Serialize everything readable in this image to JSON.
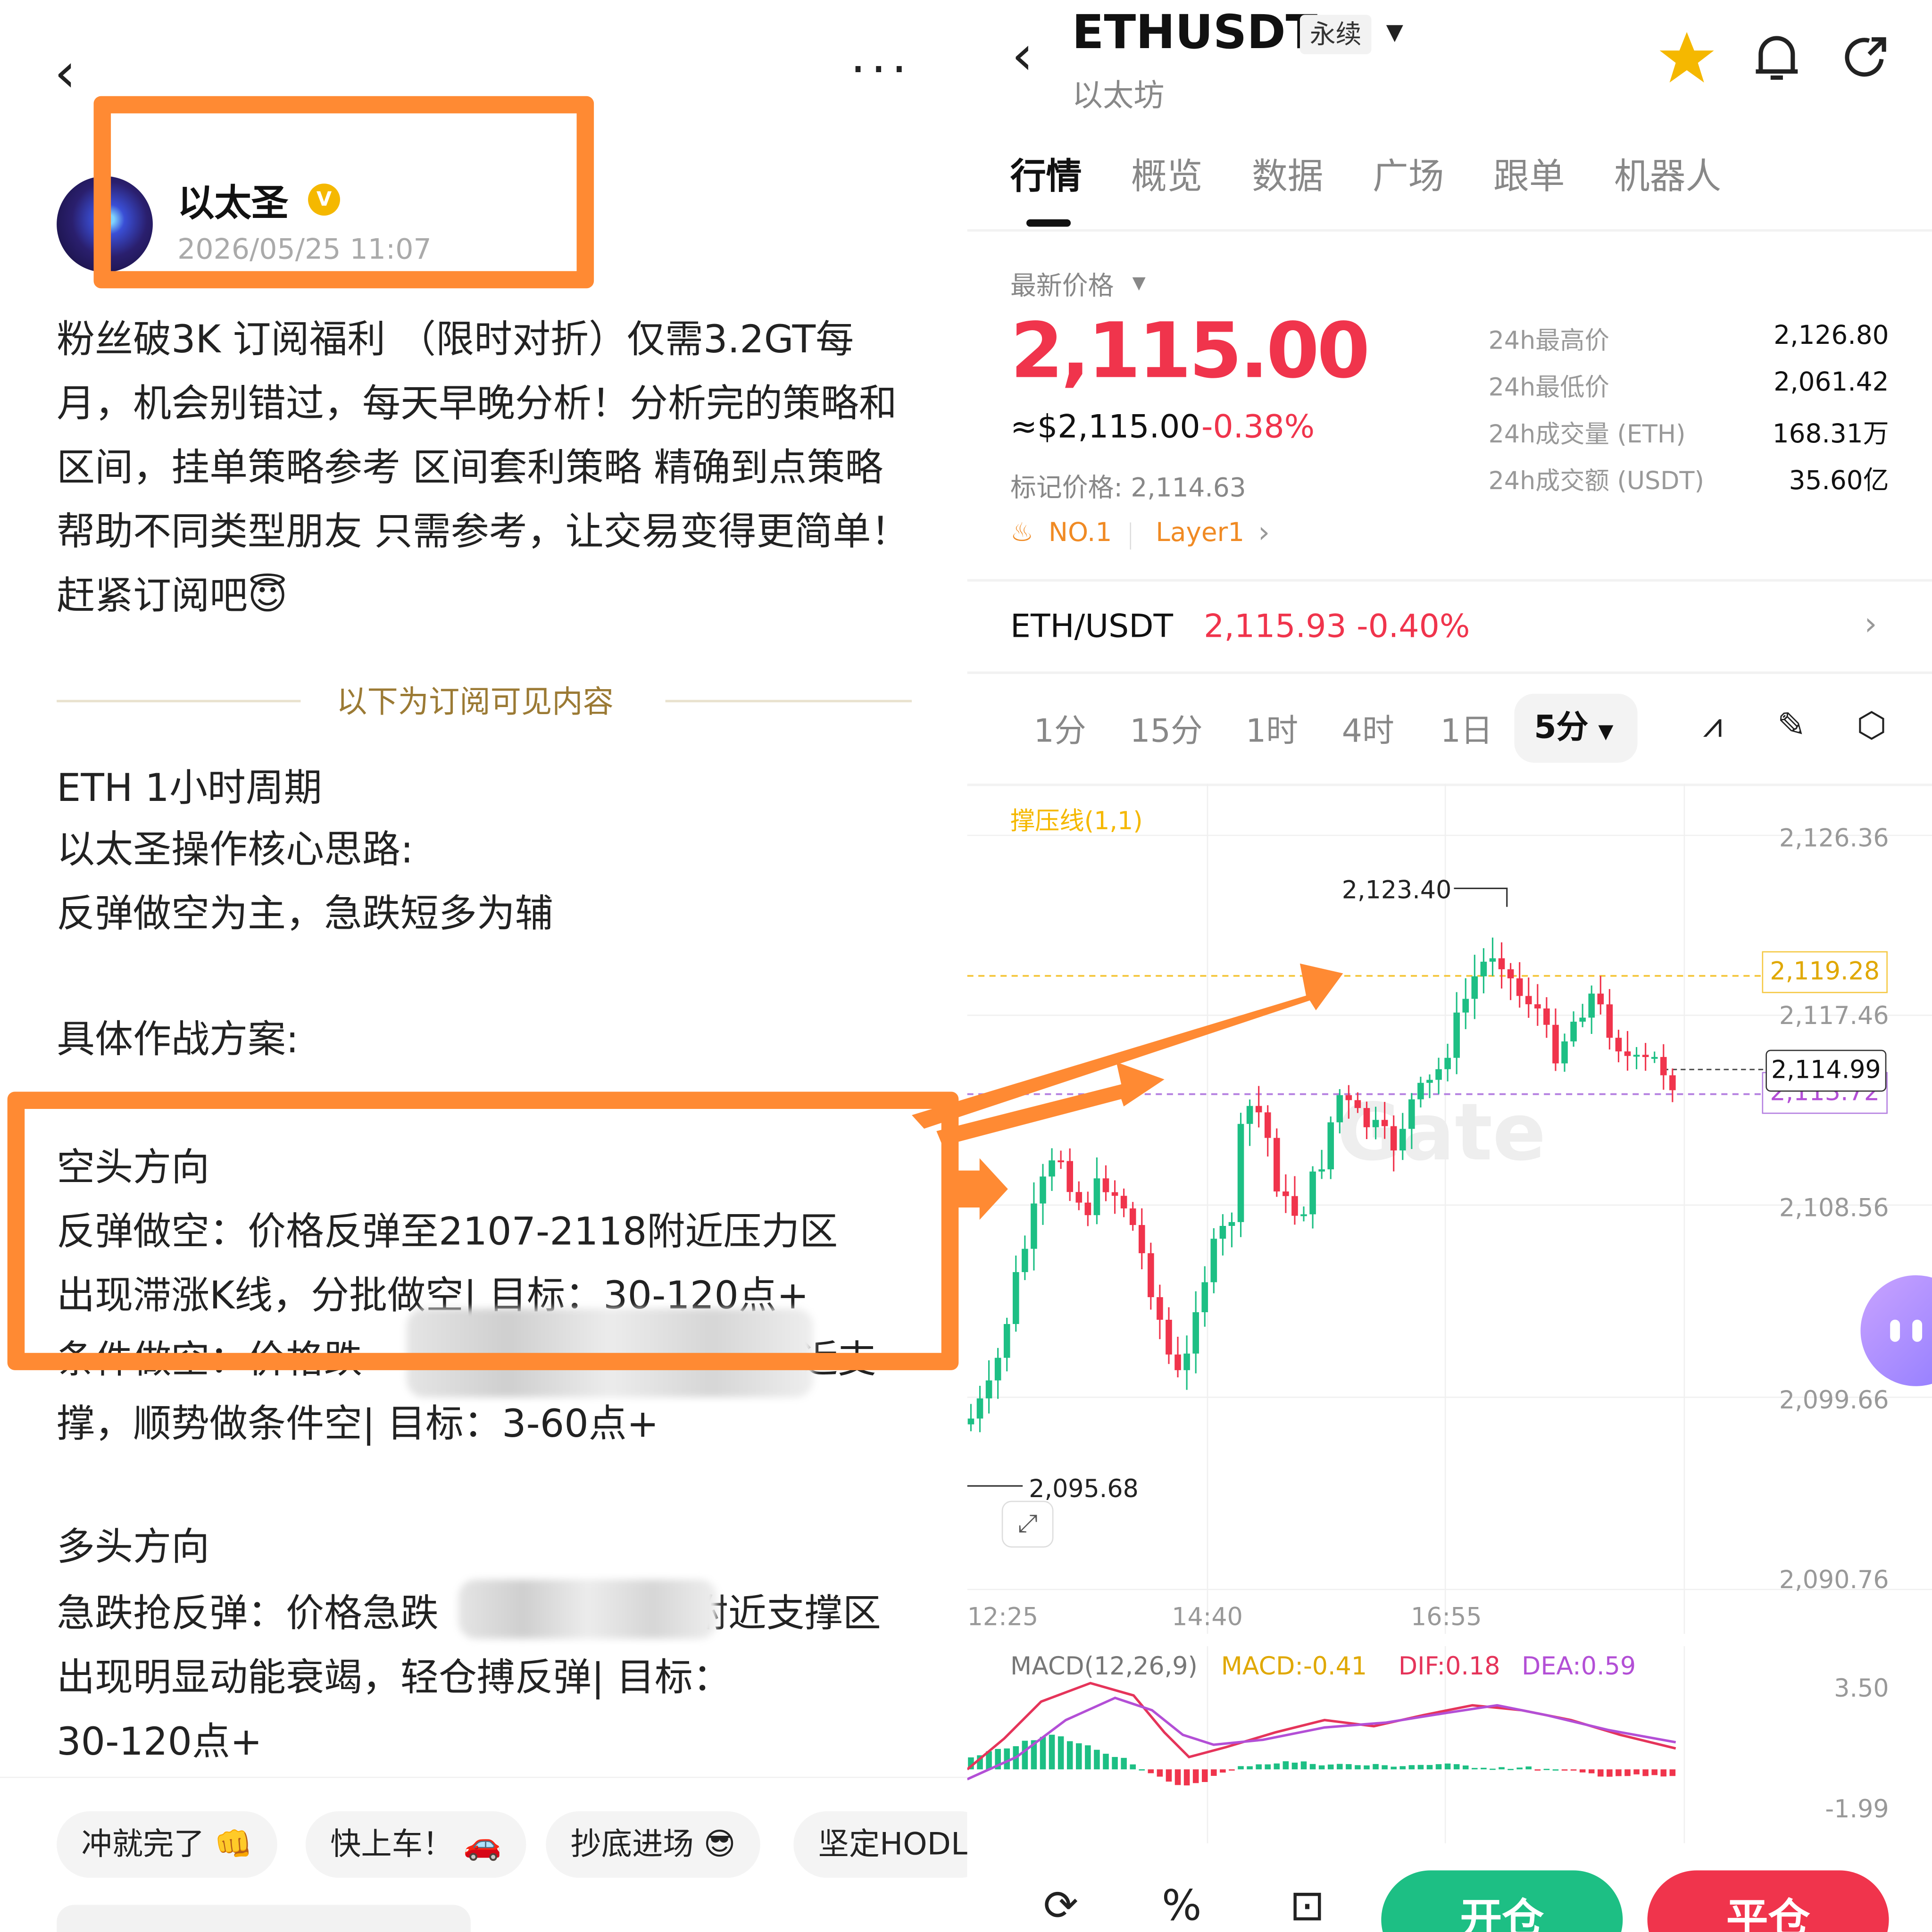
{
  "post": {
    "author": "以太圣",
    "verified_badge": "V",
    "timestamp": "2026/05/25 11:07",
    "intro": "粉丝破3K 订阅福利 （限时对折）仅需3.2GT每月，机会别错过，每天早晚分析！分析完的策略和区间，挂单策略参考 区间套利策略 精确到点策略帮助不同类型朋友 只需参考，让交易变得更简单！赶紧订阅吧😇",
    "subscribe_divider": "以下为订阅可见内容",
    "lines": [
      "ETH 1小时周期",
      "以太圣操作核心思路:",
      "反弹做空为主，急跌短多为辅",
      "具体作战方案:",
      "空头方向",
      "反弹做空：价格反弹至2107-2118附近压力区",
      "出现滞涨K线，分批做空| 目标：30-120点+",
      "条件做空：价格跌",
      "附近支",
      "撑，顺势做条件空| 目标：3-60点+",
      "多头方向",
      "急跌抢反弹：价格急跌",
      "附近支撑区",
      "出现明显动能衰竭，轻仓搏反弹| 目标：",
      "30-120点+"
    ],
    "reactions": [
      "冲就完了 👊",
      "快上车！ 🚗",
      "抄底进场 😎",
      "坚定HODL"
    ]
  },
  "ticker": {
    "symbol": "ETHUSDT",
    "contract_type": "永续",
    "name": "以太坊",
    "tabs": [
      "行情",
      "概览",
      "数据",
      "广场",
      "跟单",
      "机器人"
    ],
    "latest_label": "最新价格",
    "price": "2,115.00",
    "usd_price": "≈$2,115.00",
    "change": "-0.38%",
    "mark_price": "标记价格: 2,114.63",
    "rank_tag": "NO.1",
    "sector_tag": "Layer1",
    "stats": [
      {
        "label": "24h最高价",
        "value": "2,126.80"
      },
      {
        "label": "24h最低价",
        "value": "2,061.42"
      },
      {
        "label": "24h成交量 (ETH)",
        "value": "168.31万"
      },
      {
        "label": "24h成交额 (USDT)",
        "value": "35.60亿"
      }
    ],
    "spot_pair": "ETH/USDT",
    "spot_price": "2,115.93",
    "spot_change": "-0.40%",
    "timeframes": [
      "1分",
      "15分",
      "1时",
      "4时",
      "1日"
    ],
    "active_timeframe": "5分",
    "indicator_label": "撑压线(1,1)",
    "watermark": "Gate",
    "price_axis": [
      "2,126.36",
      "2,117.46",
      "2,108.56",
      "2,099.66",
      "2,090.76"
    ],
    "hi_label": "2,123.40",
    "lo_label": "2,095.68",
    "line_yellow": "2,119.28",
    "line_current": "2,114.99",
    "line_purple": "2,113.72",
    "time_axis": [
      "12:25",
      "14:40",
      "16:55"
    ],
    "macd_title": "MACD(12,26,9)",
    "macd_val": "MACD:-0.41",
    "dif_val": "DIF:0.18",
    "dea_val": "DEA:0.59",
    "macd_axis": [
      "3.50",
      "-1.99"
    ],
    "open_btn": "开仓",
    "close_btn": "平仓"
  },
  "colors": {
    "up": "#1dbf84",
    "down": "#f0344c",
    "accent": "#ff8a33",
    "gold": "#f5b800",
    "purple": "#b34fd6"
  }
}
